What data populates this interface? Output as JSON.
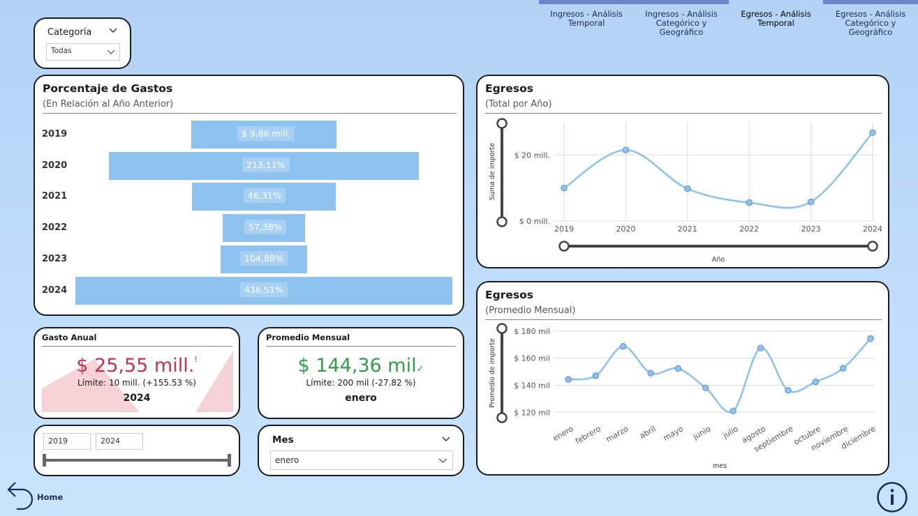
{
  "nav": {
    "tabs": [
      {
        "label1": "Ingresos - Análisis",
        "label2": "Temporal"
      },
      {
        "label1": "Ingresos - Análisis",
        "label2": "Categórico y Geográfico"
      },
      {
        "label1": "Egresos - Análisis",
        "label2": "Temporal"
      },
      {
        "label1": "Egresos - Análisis",
        "label2": "Categórico y Geográfico"
      }
    ],
    "home_label": "Home"
  },
  "categoria_slicer": {
    "title": "Categoría",
    "value": "Todas"
  },
  "porcentaje": {
    "title": "Porcentaje de Gastos",
    "subtitle": "(En Relación al Año Anterior)",
    "rows": [
      {
        "year": "2019",
        "label": "$ 9,86 mill."
      },
      {
        "year": "2020",
        "label": "213,11%"
      },
      {
        "year": "2021",
        "label": "46,31%"
      },
      {
        "year": "2022",
        "label": "57,38%"
      },
      {
        "year": "2023",
        "label": "104,88%"
      },
      {
        "year": "2024",
        "label": "436,51%"
      }
    ]
  },
  "gasto_anual": {
    "title": "Gasto Anual",
    "value": "$ 25,55 mill.",
    "flag": "!",
    "limit": "Límite: 10 mill. (+155.53 %)",
    "period": "2024",
    "value_color": "#c4314b"
  },
  "promedio_mensual": {
    "title": "Promedio Mensual",
    "value": "$ 144,36 mil",
    "flag": "✓",
    "limit": "Límite: 200 mil (-27.82 %)",
    "period": "enero",
    "value_color": "#2e9f48"
  },
  "year_slicer": {
    "from": "2019",
    "to": "2024"
  },
  "mes_slicer": {
    "title": "Mes",
    "value": "enero"
  },
  "egresos_anual": {
    "title": "Egresos",
    "subtitle": "(Total por Año)",
    "chart_data": {
      "type": "line",
      "x": [
        "2019",
        "2020",
        "2021",
        "2022",
        "2023",
        "2024"
      ],
      "series": [
        {
          "values": [
            10.0,
            21.5,
            9.8,
            5.6,
            5.8,
            26.8
          ]
        }
      ],
      "ylabel": "Suma de importe",
      "xlabel": "Año",
      "y_ticks": [
        "$ 0 mill.",
        "$ 20 mill."
      ],
      "ylim": [
        0,
        30
      ],
      "grid": true,
      "color": "#8ec3f0"
    }
  },
  "egresos_mensual": {
    "title": "Egresos",
    "subtitle": "(Promedio Mensual)",
    "chart_data": {
      "type": "line",
      "x": [
        "enero",
        "febrero",
        "marzo",
        "abril",
        "mayo",
        "junio",
        "julio",
        "agosto",
        "septiembre",
        "octubre",
        "noviembre",
        "diciembre"
      ],
      "series": [
        {
          "values": [
            144.3,
            147.0,
            168.7,
            148.9,
            152.3,
            138.0,
            121.0,
            167.5,
            136.2,
            142.5,
            152.5,
            174.5
          ]
        }
      ],
      "ylabel": "Promedio de importe",
      "xlabel": "mes",
      "y_ticks": [
        "$ 120 mil",
        "$ 140 mil",
        "$ 160 mil",
        "$ 180 mil"
      ],
      "ylim": [
        115,
        183
      ],
      "grid": true,
      "color": "#8ec3f0"
    }
  }
}
